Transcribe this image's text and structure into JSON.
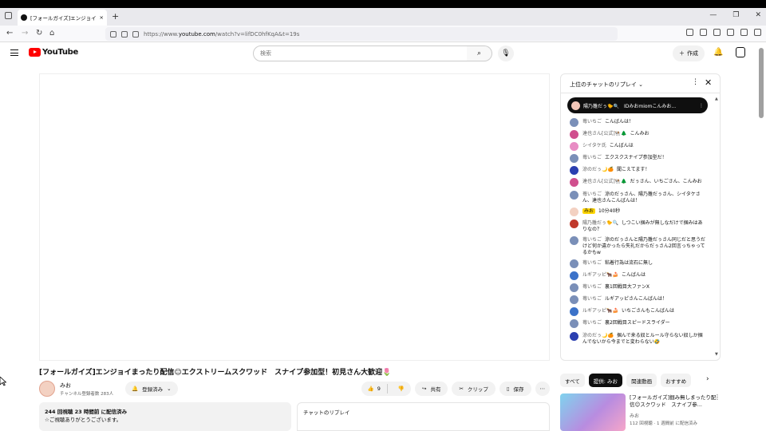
{
  "browser": {
    "tab_title": "[フォールガイズ]エンジョイまったり配信",
    "tab_close": "×",
    "new_tab": "+",
    "url_domain_prefix": "https://www.",
    "url_domain": "youtube.com",
    "url_path": "/watch?v=lifDC0hfKqA&t=19s",
    "window_minimize": "—",
    "window_restore": "❐",
    "window_close": "✕"
  },
  "header": {
    "logo_text": "YouTube",
    "search_placeholder": "検索",
    "create_label": "作成"
  },
  "video": {
    "title": "[フォールガイズ]エンジョイまったり配信☺エクストリームスクワッド　スナイプ参加型！初見さん大歓迎🌷",
    "channel_name": "みお",
    "subscribers": "チャンネル登録者数 283人",
    "subscribe_label": "登録済み",
    "likes": "9",
    "share_label": "共有",
    "clip_label": "クリップ",
    "save_label": "保存"
  },
  "description": {
    "views": "244 回視聴  23 時間前 に配信済み",
    "line2": "☆ご視聴ありがとうございます。"
  },
  "chat_replay_label": "チャットのリプレイ",
  "chat": {
    "header_title": "上位のチャットのリプレイ",
    "pinned_author": "陽乃雛だぅ🐤🔍",
    "pinned_text": "IDみおmiomこんみお...",
    "messages": [
      {
        "author": "苺いちご",
        "text": "こんばんは！",
        "color": "#7a8fb8",
        "owner": false
      },
      {
        "author": "達也さん[公式]🐏🌲",
        "text": "こんみお",
        "color": "#d04f8e",
        "owner": false
      },
      {
        "author": "シイタケ氏",
        "text": "こんばんは",
        "color": "#e88cc4",
        "owner": false
      },
      {
        "author": "苺いちご",
        "text": "エクスクスナイプ参加型だ！",
        "color": "#7a8fb8",
        "owner": false
      },
      {
        "author": "涼のだぅ🌙🍊",
        "text": "聞こえてます！",
        "color": "#2b3fb0",
        "owner": false
      },
      {
        "author": "達也さん[公式]🐏🌲",
        "text": "だぅさん、いちごさん、こんみお",
        "color": "#d04f8e",
        "owner": false
      },
      {
        "author": "苺いちご",
        "text": "涼のだぅさん、陽乃雛だぅさん、シイタケさん、達也さんこんばんは！",
        "color": "#7a8fb8",
        "owner": false
      },
      {
        "author": "みお",
        "text": "10分40秒",
        "color": "#f3d1c2",
        "owner": true
      },
      {
        "author": "陽乃雛だぅ🐤🔍",
        "text": "しつこい掴みが無しなだけで掴みはありなの？",
        "color": "#c0392b",
        "owner": false
      },
      {
        "author": "苺いちご",
        "text": "涼のだぅさんと陽乃雛だぅさん同じだと思うだけど何か違かったら失礼だからだぅさん2回言っちゃってるかもw",
        "color": "#7a8fb8",
        "owner": false
      },
      {
        "author": "苺いちご",
        "text": "粘着行為は流石に無し",
        "color": "#7a8fb8",
        "owner": false
      },
      {
        "author": "ルギアッピ🐂🍰",
        "text": "こんばんは",
        "color": "#3b72c9",
        "owner": false
      },
      {
        "author": "苺いちご",
        "text": "裏1回戦目大ファンX",
        "color": "#7a8fb8",
        "owner": false
      },
      {
        "author": "苺いちご",
        "text": "ルギアッピさんこんばんは！",
        "color": "#7a8fb8",
        "owner": false
      },
      {
        "author": "ルギアッピ🐂🍰",
        "text": "いちごさんもこんばんは",
        "color": "#3b72c9",
        "owner": false
      },
      {
        "author": "苺いちご",
        "text": "裏2回戦目スピードスライダー",
        "color": "#7a8fb8",
        "owner": false
      },
      {
        "author": "涼のだぅ🌙🍊",
        "text": "掴んで来る奴とルール守らない奴しか掴んでないから今までと変わらない🤣",
        "color": "#2b3fb0",
        "owner": false
      }
    ]
  },
  "chips": [
    {
      "label": "すべて",
      "active": false
    },
    {
      "label": "提供: みお",
      "active": true
    },
    {
      "label": "関連動画",
      "active": false
    },
    {
      "label": "おすすめ",
      "active": false
    }
  ],
  "recommendation": {
    "title": "[フォールガイズ]掴み無しまったり配信☺スクワッド　スナイプ参...",
    "channel": "みお",
    "meta": "112 回視聴 · 1 週間前 に配信済み"
  },
  "colors": {
    "youtube_red": "#ff0000",
    "owner_badge": "#ffd600"
  }
}
